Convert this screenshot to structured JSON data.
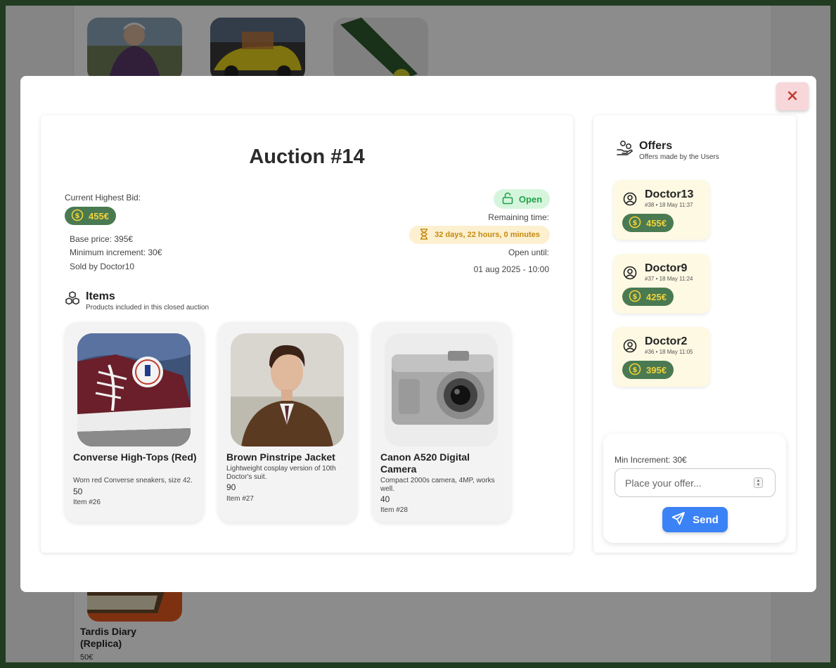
{
  "background": {
    "cards": [
      {
        "name": "Tardis Diary (Replica)",
        "price": "50€"
      }
    ]
  },
  "modal": {
    "close_icon": "x-icon",
    "auction": {
      "title": "Auction #14",
      "current_bid_label": "Current Highest Bid:",
      "current_bid": "455€",
      "base_price": "Base price: 395€",
      "min_increment": "Minimum increment: 30€",
      "sold_by": "Sold by Doctor10",
      "status": "Open",
      "remaining_label": "Remaining time:",
      "remaining": "32 days, 22 hours, 0 minutes",
      "open_until_label": "Open until:",
      "open_until": "01 aug 2025 - 10:00"
    },
    "items_section": {
      "title": "Items",
      "subtitle": "Products included in this closed auction"
    },
    "items": [
      {
        "name": "Converse High-Tops (Red)",
        "desc": "Worn red Converse sneakers, size 42.",
        "price": "50",
        "id": "Item #26"
      },
      {
        "name": "Brown Pinstripe Jacket",
        "desc": "Lightweight cosplay version of 10th Doctor's suit.",
        "price": "90",
        "id": "Item #27"
      },
      {
        "name": "Canon A520 Digital Camera",
        "desc": "Compact 2000s camera, 4MP, works well.",
        "price": "40",
        "id": "Item #28"
      }
    ],
    "offers_section": {
      "title": "Offers",
      "subtitle": "Offers made by the Users"
    },
    "offers": [
      {
        "user": "Doctor13",
        "meta": "#38 • 18 May 11:37",
        "amount": "455€"
      },
      {
        "user": "Doctor9",
        "meta": "#37 • 18 May 11:24",
        "amount": "425€"
      },
      {
        "user": "Doctor2",
        "meta": "#36 • 18 May 11:05",
        "amount": "395€"
      }
    ],
    "offer_form": {
      "min_increment": "Min Increment: 30€",
      "placeholder": "Place your offer...",
      "send_label": "Send"
    }
  },
  "colors": {
    "money_badge": "#4a7a51",
    "money_text": "#f4d23a",
    "open_green": "#22a24a",
    "send_blue": "#3b82f6"
  }
}
